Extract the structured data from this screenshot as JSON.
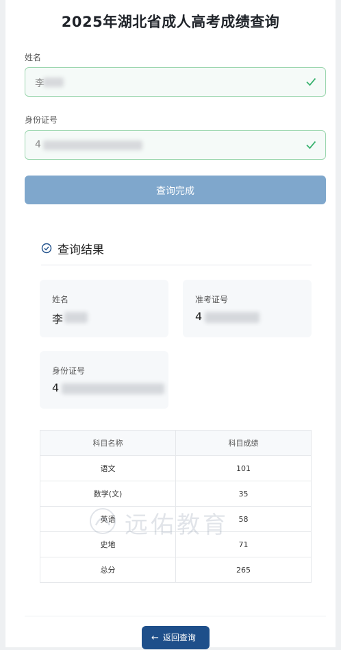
{
  "title": "2025年湖北省成人高考成绩查询",
  "form": {
    "name_label": "姓名",
    "name_value": "李",
    "id_label": "身份证号",
    "id_value": "4",
    "submit_label": "查询完成"
  },
  "result": {
    "heading": "查询结果",
    "cards": {
      "name_label": "姓名",
      "name_value": "李",
      "exam_label": "准考证号",
      "exam_value": "4",
      "id_label": "身份证号",
      "id_value": "4"
    },
    "table": {
      "headers": [
        "科目名称",
        "科目成绩"
      ],
      "rows": [
        [
          "语文",
          "101"
        ],
        [
          "数学(文)",
          "35"
        ],
        [
          "英语",
          "58"
        ],
        [
          "史地",
          "71"
        ],
        [
          "总分",
          "265"
        ]
      ]
    }
  },
  "watermark": "远佑教育",
  "back_label": "返回查询",
  "colors": {
    "valid_border": "#9bd6ae",
    "check": "#3cb371",
    "submit_bg": "#7fa7cc",
    "back_bg": "#1e4f8a"
  },
  "icons": {
    "field_status": "check-icon",
    "result_header": "check-circle-icon",
    "back": "arrow-left-icon"
  }
}
